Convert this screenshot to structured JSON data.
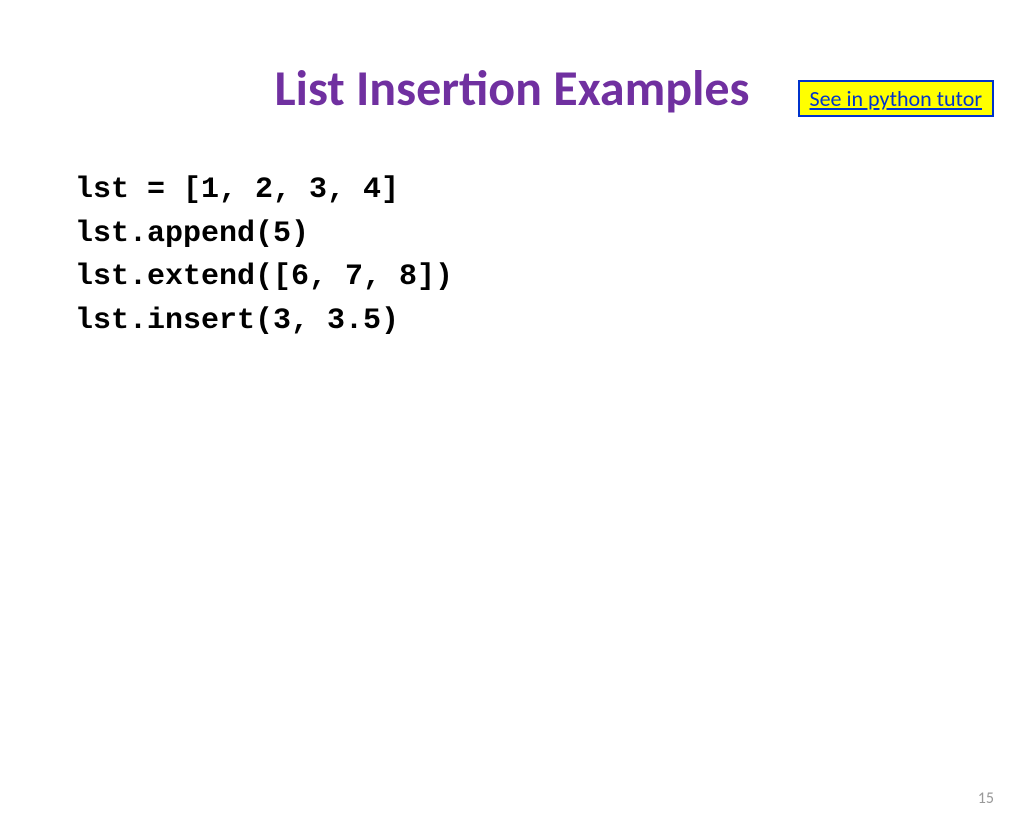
{
  "tutor_link": "See in python tutor",
  "title": "List Insertion Examples",
  "code": {
    "line1": "lst = [1, 2, 3, 4]",
    "line2": "lst.append(5)",
    "line3": "lst.extend([6, 7, 8])",
    "line4": "lst.insert(3, 3.5)"
  },
  "page_number": "15"
}
